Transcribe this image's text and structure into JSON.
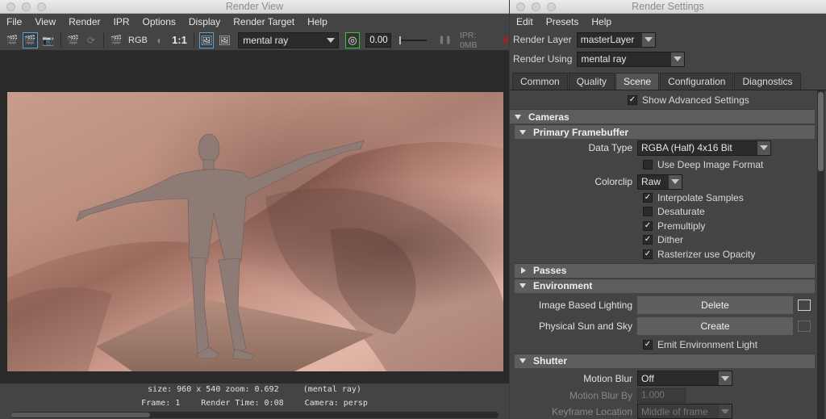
{
  "render_view": {
    "title": "Render View",
    "menu": [
      "File",
      "View",
      "Render",
      "IPR",
      "Options",
      "Display",
      "Render Target",
      "Help"
    ],
    "toolbar": {
      "rgb_label": "RGB",
      "ratio_label": "1:1",
      "renderer": "mental ray",
      "exposure": "0.00",
      "ipr_memory": "IPR: 0MB",
      "icons": [
        "render-frame-icon",
        "render-region-icon",
        "snapshot-icon",
        "ipr-render-icon",
        "refresh-ipr-icon",
        "render-settings-icon",
        "rgb-channels-icon",
        "alpha-icon",
        "real-size-icon",
        "keep-image-icon",
        "remove-image-icon",
        "snapshot-camera-icon",
        "pause-icon",
        "stop-icon"
      ]
    },
    "status": {
      "size_line": "size: 960 x 540 zoom: 0.692",
      "renderer_tag": "(mental ray)",
      "frame": "Frame: 1",
      "render_time": "Render Time: 0:08",
      "camera": "Camera: persp"
    }
  },
  "render_settings": {
    "title": "Render Settings",
    "menu": [
      "Edit",
      "Presets",
      "Help"
    ],
    "render_layer_label": "Render Layer",
    "render_layer_value": "masterLayer",
    "render_using_label": "Render Using",
    "render_using_value": "mental ray",
    "tabs": [
      "Common",
      "Quality",
      "Scene",
      "Configuration",
      "Diagnostics"
    ],
    "active_tab": "Scene",
    "show_advanced_label": "Show Advanced Settings",
    "sections": {
      "cameras": "Cameras",
      "primary_framebuffer": "Primary Framebuffer",
      "passes": "Passes",
      "environment": "Environment",
      "shutter": "Shutter"
    },
    "framebuffer": {
      "data_type_label": "Data Type",
      "data_type_value": "RGBA (Half)  4x16 Bit",
      "use_deep_label": "Use Deep Image Format",
      "colorclip_label": "Colorclip",
      "colorclip_value": "Raw",
      "checks": [
        {
          "label": "Interpolate Samples",
          "checked": true
        },
        {
          "label": "Desaturate",
          "checked": false
        },
        {
          "label": "Premultiply",
          "checked": true
        },
        {
          "label": "Dither",
          "checked": true
        },
        {
          "label": "Rasterizer use Opacity",
          "checked": true
        }
      ]
    },
    "environment": {
      "ibl_label": "Image Based Lighting",
      "ibl_button": "Delete",
      "sun_label": "Physical Sun and Sky",
      "sun_button": "Create",
      "emit_label": "Emit Environment Light"
    },
    "shutter": {
      "motion_blur_label": "Motion Blur",
      "motion_blur_value": "Off",
      "motion_blur_by_label": "Motion Blur By",
      "motion_blur_by_value": "1.000",
      "keyframe_location_label": "Keyframe Location",
      "keyframe_location_value": "Middle of frame"
    }
  }
}
